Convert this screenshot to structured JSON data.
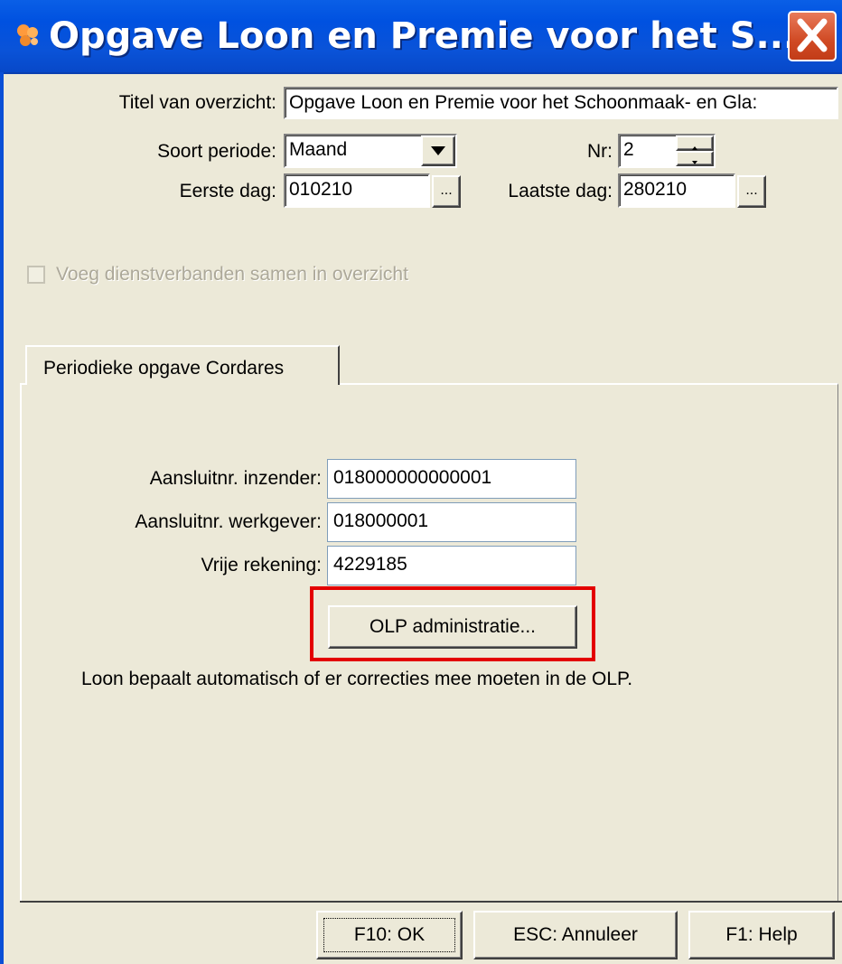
{
  "window": {
    "title": "Opgave Loon en Premie voor het S...",
    "close_icon": "close-icon"
  },
  "form": {
    "title_label": "Titel van overzicht:",
    "title_value": "Opgave Loon en Premie voor het Schoonmaak- en Gla:",
    "period_type_label": "Soort periode:",
    "period_type_value": "Maand",
    "nr_label": "Nr:",
    "nr_value": "2",
    "first_day_label": "Eerste dag:",
    "first_day_value": "010210",
    "last_day_label": "Laatste dag:",
    "last_day_value": "280210",
    "browse_label": "...",
    "merge_label": "Voeg dienstverbanden samen in overzicht",
    "merge_checked": false
  },
  "tabs": [
    {
      "label": "Periodieke opgave Cordares"
    }
  ],
  "cordares": {
    "submitter_label": "Aansluitnr. inzender:",
    "submitter_value": "018000000000001",
    "employer_label": "Aansluitnr. werkgever:",
    "employer_value": "018000001",
    "free_account_label": "Vrije rekening:",
    "free_account_value": "4229185",
    "olp_button": "OLP administratie...",
    "info_text": "Loon bepaalt automatisch of er correcties mee moeten in de OLP."
  },
  "footer": {
    "ok_label": "F10: OK",
    "cancel_label": "ESC: Annuleer",
    "help_label": "F1: Help"
  },
  "colors": {
    "titlebar": "#0051e0",
    "highlight": "#e30000",
    "dialog_bg": "#ece9d8"
  }
}
